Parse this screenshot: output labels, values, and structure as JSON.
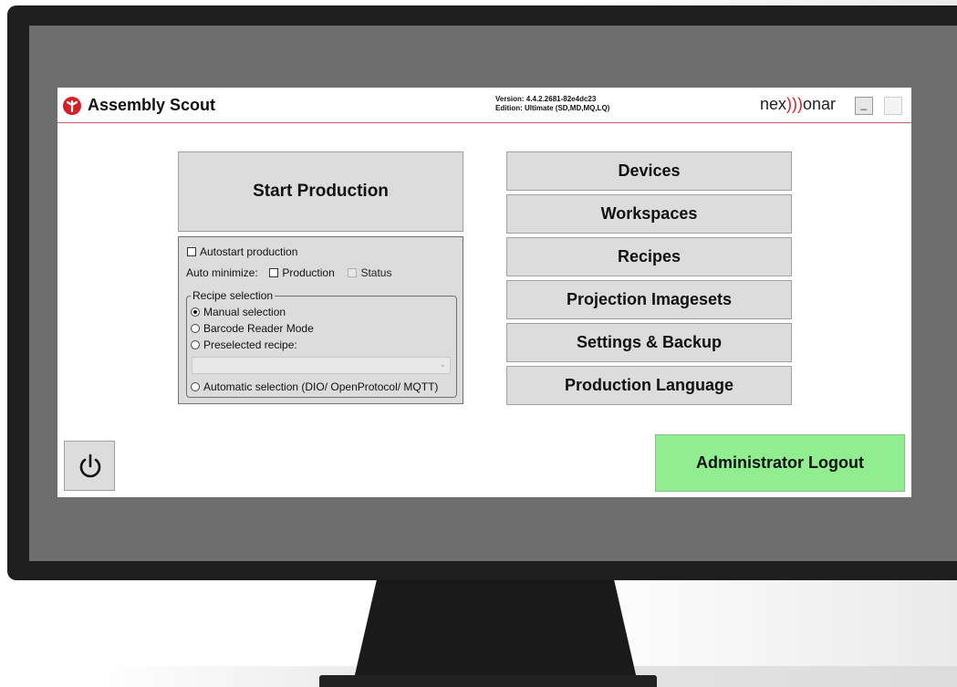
{
  "app": {
    "title": "Assembly Scout",
    "version_line": "Version: 4.4.2.2681-82e4dc23",
    "edition_line": "Edition: Ultimate (SD,MD,MQ,LQ)",
    "brand_prefix": "nex",
    "brand_parens": ")))",
    "brand_suffix": "onar",
    "minimize_label": "_",
    "logo_icon": "assembly-scout-logo-icon"
  },
  "production": {
    "start_label": "Start Production",
    "autostart_label": "Autostart production",
    "autostart_checked": false,
    "auto_minimize_label": "Auto minimize:",
    "minimize_production_label": "Production",
    "minimize_status_label": "Status",
    "recipe_selection": {
      "legend": "Recipe selection",
      "options": [
        "Manual selection",
        "Barcode Reader Mode",
        "Preselected recipe:",
        "Automatic selection (DIO/ OpenProtocol/ MQTT)"
      ],
      "selected": "Manual selection",
      "preselected_value": ""
    }
  },
  "menu": {
    "items": [
      "Devices",
      "Workspaces",
      "Recipes",
      "Projection Imagesets",
      "Settings & Backup",
      "Production Language"
    ]
  },
  "footer": {
    "power_icon": "power-icon",
    "logout_label": "Administrator Logout"
  },
  "colors": {
    "accent_red": "#d62027",
    "logout_green": "#90ee90",
    "button_gray": "#dcdcdc"
  }
}
